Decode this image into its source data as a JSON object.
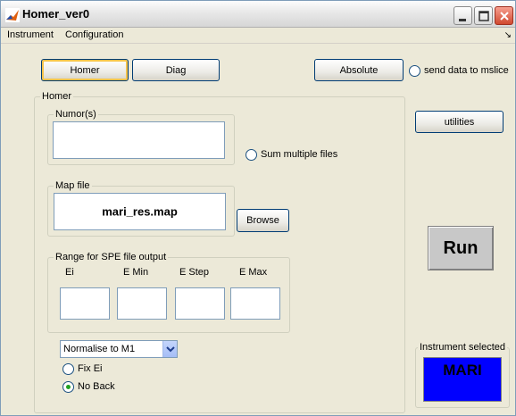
{
  "window": {
    "title": "Homer_ver0"
  },
  "menubar": {
    "items": [
      "Instrument",
      "Configuration"
    ],
    "corner_icon": "↘"
  },
  "top_buttons": {
    "homer": "Homer",
    "diag": "Diag",
    "absolute": "Absolute",
    "send_to_mslice": "send data to mslice",
    "utilities": "utilities"
  },
  "homer_panel": {
    "title": "Homer",
    "numors": {
      "title": "Numor(s)",
      "value": ""
    },
    "sum_multiple_files": "Sum multiple files",
    "map_file": {
      "title": "Map file",
      "value": "mari_res.map",
      "browse": "Browse"
    },
    "range": {
      "title": "Range for SPE file output",
      "columns": [
        "Ei",
        "E Min",
        "E Step",
        "E Max"
      ],
      "values": [
        "",
        "",
        "",
        ""
      ]
    },
    "normalise": {
      "selected": "Normalise to M1"
    },
    "fix_ei": "Fix Ei",
    "no_back": "No Back"
  },
  "run_label": "Run",
  "instrument": {
    "title": "Instrument selected",
    "name": "MARI",
    "color": "#0000ff"
  },
  "icons": {
    "app": "matlab-icon",
    "minimize": "minimize-icon",
    "maximize": "maximize-icon",
    "close": "close-icon",
    "dropdown": "chevron-down-icon"
  }
}
